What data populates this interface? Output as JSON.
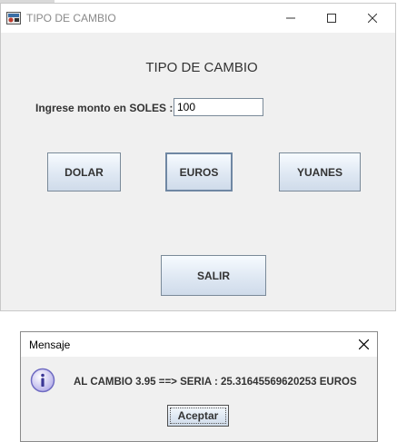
{
  "main_window": {
    "title": "TIPO DE CAMBIO",
    "heading": "TIPO DE CAMBIO",
    "amount_label": "Ingrese monto en SOLES :",
    "amount_value": "100",
    "buttons": {
      "dolar": "DOLAR",
      "euros": "EUROS",
      "yuanes": "YUANES",
      "salir": "SALIR"
    }
  },
  "dialog": {
    "title": "Mensaje",
    "message": "AL CAMBIO 3.95 ==> SERIA  : 25.31645569620253  EUROS",
    "ok_label": "Aceptar"
  },
  "colors": {
    "window_bg": "#f0f0f0",
    "button_border": "#7a8a99",
    "info_icon_fill": "#c9c4ee",
    "info_icon_stroke": "#6f6bc2"
  }
}
